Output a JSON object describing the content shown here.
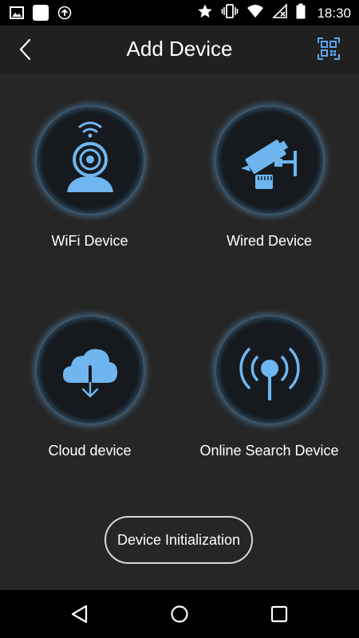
{
  "status_bar": {
    "time": "18:30",
    "left_icons": [
      "image-icon",
      "square-app-icon",
      "upload-icon"
    ],
    "right_icons": [
      "star-icon",
      "vibrate-icon",
      "wifi-icon",
      "no-signal-icon",
      "battery-icon"
    ]
  },
  "header": {
    "title": "Add Device",
    "back_icon": "chevron-left-icon",
    "qr_icon": "qr-code-icon"
  },
  "devices": [
    {
      "label": "WiFi Device",
      "icon": "wifi-camera-icon"
    },
    {
      "label": "Wired Device",
      "icon": "wired-camera-icon"
    },
    {
      "label": "Cloud device",
      "icon": "cloud-download-icon"
    },
    {
      "label": "Online Search Device",
      "icon": "broadcast-antenna-icon"
    }
  ],
  "init_button": {
    "label": "Device Initialization"
  },
  "navigation": {
    "icons": [
      "back-triangle-icon",
      "home-circle-icon",
      "recents-square-icon"
    ]
  },
  "colors": {
    "accent": "#6fb6f0",
    "background": "#262626",
    "header": "#202020",
    "bars": "#000000"
  }
}
